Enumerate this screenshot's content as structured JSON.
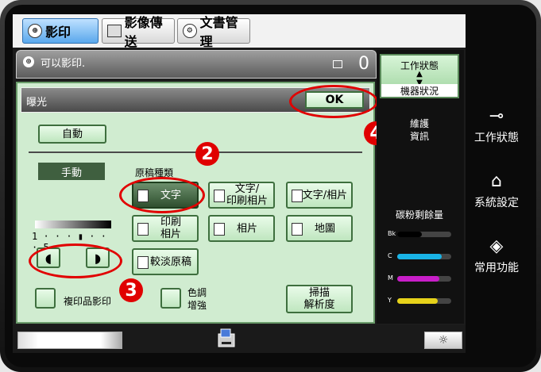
{
  "tabs": [
    {
      "label": "影印",
      "active": true
    },
    {
      "label": "影像傳送",
      "active": false
    },
    {
      "label": "文書管理",
      "active": false
    }
  ],
  "status": {
    "message": "可以影印.",
    "count": "0"
  },
  "panel": {
    "title": "曝光",
    "ok_label": "OK",
    "auto_label": "自動",
    "manual_label": "手動",
    "original_type_label": "原稿種類",
    "scale_text": "1 · · · ▮ · · · 5",
    "exposure_level": 3,
    "types": [
      {
        "label": "文字",
        "selected": true
      },
      {
        "label": "文字/\n印刷相片",
        "selected": false
      },
      {
        "label": "文字/相片",
        "selected": false
      },
      {
        "label": "印刷\n相片",
        "selected": false
      },
      {
        "label": "相片",
        "selected": false
      },
      {
        "label": "地圖",
        "selected": false
      },
      {
        "label": "較淡原稿",
        "selected": false
      }
    ],
    "copy_of_copy_label": "複印品影印",
    "tone_enhance_label": "色調\n增強",
    "scan_resolution_label": "掃描\n解析度"
  },
  "callouts": [
    "2",
    "3",
    "4"
  ],
  "right": {
    "job_status_top": "工作狀態",
    "job_status_bottom": "機器狀況",
    "maintenance": "維護\n資訊",
    "toner_title": "碳粉剩餘量",
    "toners": [
      {
        "label": "Bk",
        "level": 0.45,
        "color": "#000000"
      },
      {
        "label": "C",
        "level": 0.82,
        "color": "#19b3e6"
      },
      {
        "label": "M",
        "level": 0.78,
        "color": "#c81ec8"
      },
      {
        "label": "Y",
        "level": 0.75,
        "color": "#e6d21a"
      }
    ]
  },
  "hardkeys": [
    {
      "label": "工作狀態",
      "icon": "job-status-icon"
    },
    {
      "label": "系統設定",
      "icon": "home-icon"
    },
    {
      "label": "常用功能",
      "icon": "diamond-icon"
    }
  ]
}
